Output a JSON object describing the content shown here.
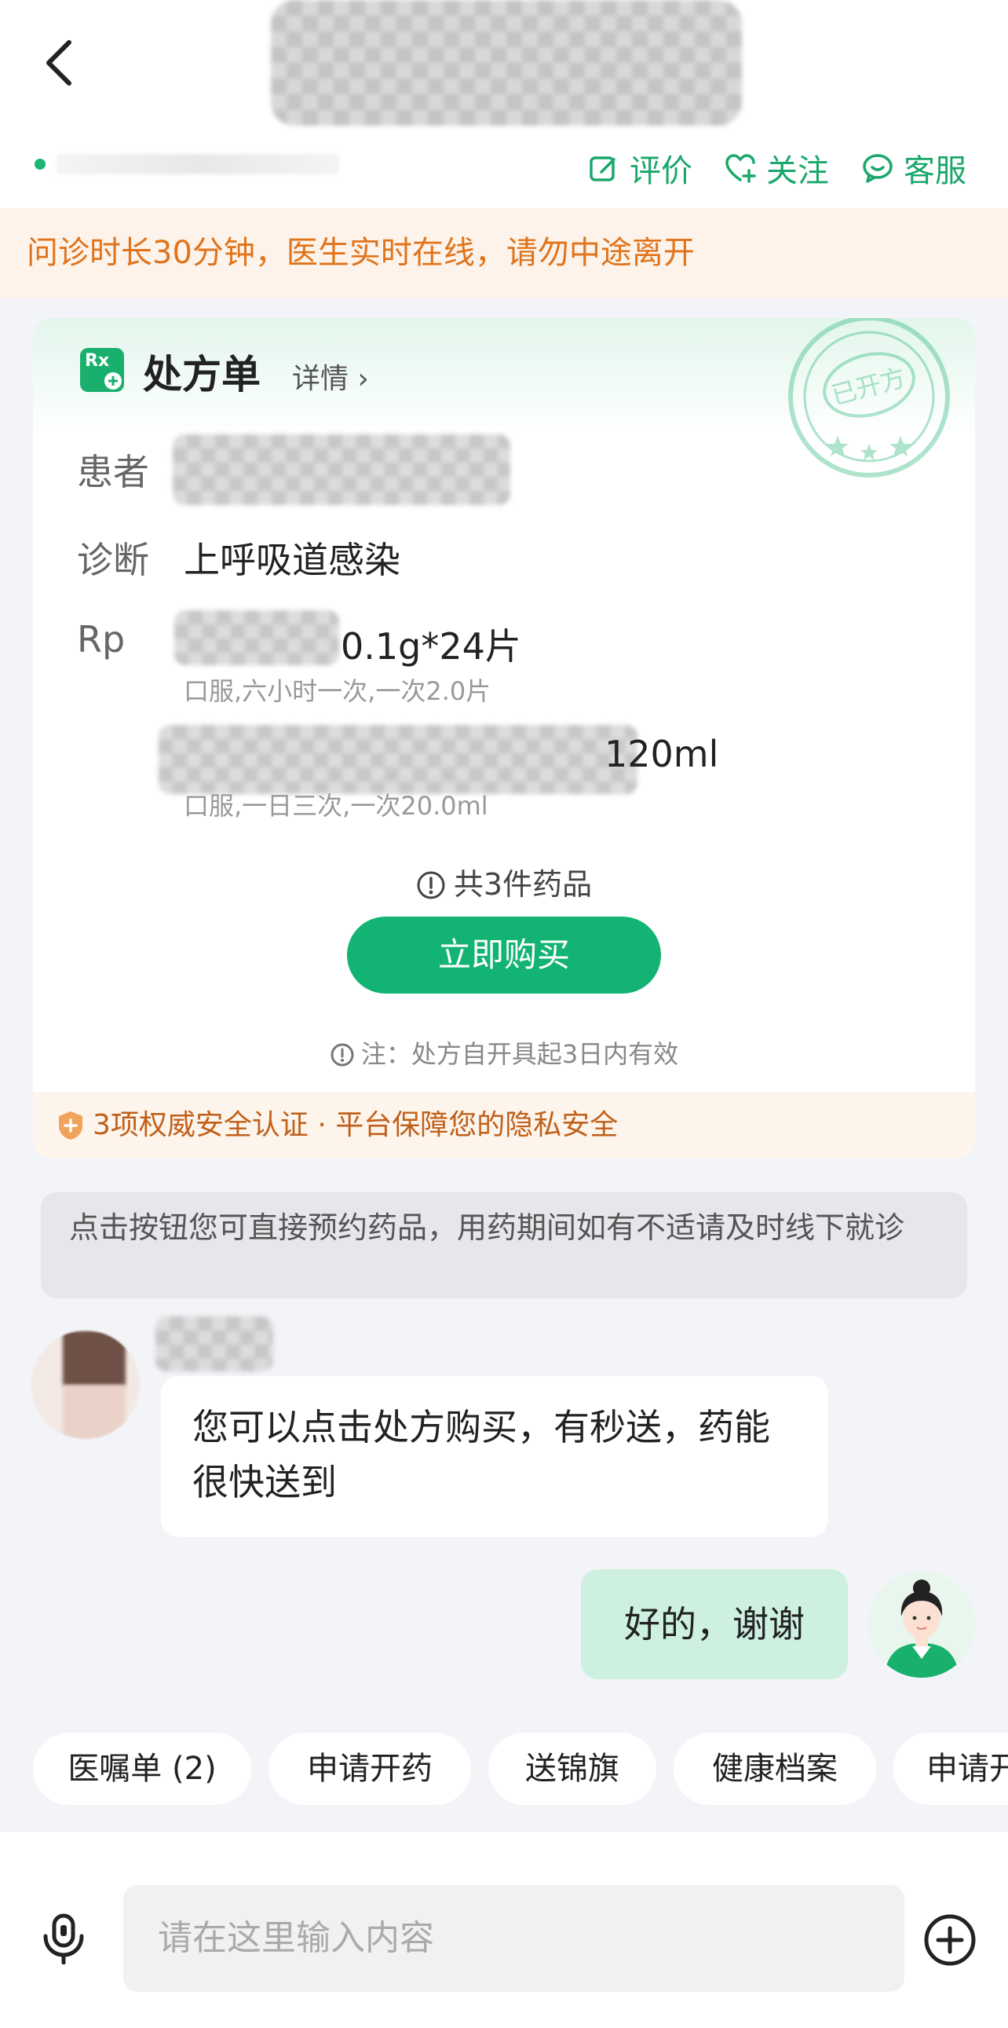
{
  "header": {
    "actions": [
      {
        "label": "评价",
        "icon": "edit-icon"
      },
      {
        "label": "关注",
        "icon": "heart-plus-icon"
      },
      {
        "label": "客服",
        "icon": "chat-smile-icon"
      }
    ]
  },
  "notice": "问诊时长30分钟，医生实时在线，请勿中途离开",
  "prescription": {
    "title": "处方单",
    "detail_link": "详情 ›",
    "rx_badge": "Rx",
    "stamp_text": "已开方",
    "patient_label": "患者",
    "diagnosis_label": "诊断",
    "diagnosis_value": "上呼吸道感染",
    "rp_label": "Rp",
    "drugs": [
      {
        "spec": "0.1g*24片",
        "usage": "口服,六小时一次,一次2.0片"
      },
      {
        "spec": "120ml",
        "usage": "口服,一日三次,一次20.0ml"
      }
    ],
    "count_text": "共3件药品",
    "buy_button": "立即购买",
    "note": "注：处方自开具起3日内有效",
    "security": "3项权威安全认证 · 平台保障您的隐私安全"
  },
  "tip": "点击按钮您可直接预约药品，用药期间如有不适请及时线下就诊",
  "messages": [
    {
      "from": "doctor",
      "text": "您可以点击处方购买，有秒送，药能很快送到"
    },
    {
      "from": "me",
      "text": "好的，谢谢"
    }
  ],
  "quick_actions": [
    "医嘱单 (2)",
    "申请开药",
    "送锦旗",
    "健康档案",
    "申请开"
  ],
  "composer": {
    "placeholder": "请在这里输入内容"
  },
  "colors": {
    "brand_green": "#13b374",
    "notice_orange": "#e0741c",
    "bg": "#f2f4f7"
  }
}
